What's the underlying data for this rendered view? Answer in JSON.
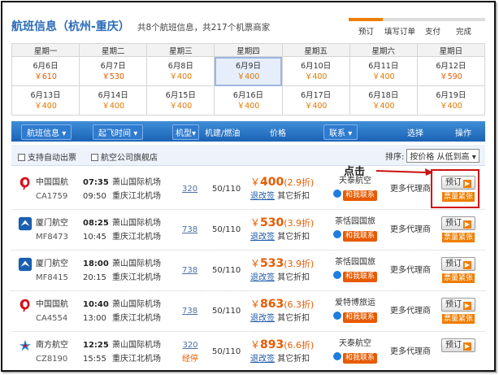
{
  "header": {
    "title": "航班信息（杭州-重庆）",
    "summary": "共8个航班信息，共217个机票商家"
  },
  "steps": [
    "预订",
    "填写订单",
    "支付",
    "完成"
  ],
  "calendar": {
    "weekdays": [
      "星期一",
      "星期二",
      "星期三",
      "星期四",
      "星期五",
      "星期六",
      "星期日"
    ],
    "weeks": [
      [
        {
          "date": "6月6日",
          "price": "￥610"
        },
        {
          "date": "6月7日",
          "price": "￥530"
        },
        {
          "date": "6月8日",
          "price": "￥400"
        },
        {
          "date": "6月9日",
          "price": "￥400"
        },
        {
          "date": "6月10日",
          "price": "￥400"
        },
        {
          "date": "6月11日",
          "price": "￥400"
        },
        {
          "date": "6月12日",
          "price": "￥590"
        }
      ],
      [
        {
          "date": "6月13日",
          "price": "￥400"
        },
        {
          "date": "6月14日",
          "price": "￥400"
        },
        {
          "date": "6月15日",
          "price": "￥400"
        },
        {
          "date": "6月16日",
          "price": "￥400"
        },
        {
          "date": "6月17日",
          "price": "￥400"
        },
        {
          "date": "6月18日",
          "price": "￥400"
        },
        {
          "date": "6月19日",
          "price": "￥400"
        }
      ]
    ],
    "selected": "6月9日"
  },
  "columns": {
    "flight_info": "航班信息",
    "depart_time": "起飞时间",
    "aircraft": "机型",
    "fuel": "机建/燃油",
    "price": "价格",
    "contact": "联系",
    "select": "选择",
    "action": "操作"
  },
  "filters": {
    "auto_issue": "支持自动出票",
    "flagship": "航空公司旗舰店",
    "sort_label": "排序:",
    "sort_value": "按价格 从低到高"
  },
  "annotation": "点击",
  "flights": [
    {
      "airline": "中国国航",
      "flight": "CA1759",
      "dep_time": "07:35",
      "arr_time": "09:50",
      "dep_airport": "萧山国际机场",
      "arr_airport": "重庆江北机场",
      "aircraft": "320",
      "aircraft_note": "",
      "fuel": "50/110",
      "price": "400",
      "discount": "(2.9折)",
      "refund": "退改签",
      "other": "其它折扣",
      "agency": "天泰航空",
      "help": "和我联系",
      "more": "更多代理商",
      "book": "预订",
      "tight": "票量紧张"
    },
    {
      "airline": "厦门航空",
      "flight": "MF8473",
      "dep_time": "08:25",
      "arr_time": "10:45",
      "dep_airport": "萧山国际机场",
      "arr_airport": "重庆江北机场",
      "aircraft": "738",
      "aircraft_note": "",
      "fuel": "50/110",
      "price": "530",
      "discount": "(3.9折)",
      "refund": "退改签",
      "other": "其它折扣",
      "agency": "茶恬园国旅",
      "help": "和我联系",
      "more": "更多代理商",
      "book": "预订",
      "tight": "票量紧张"
    },
    {
      "airline": "厦门航空",
      "flight": "MF8415",
      "dep_time": "18:00",
      "arr_time": "20:15",
      "dep_airport": "萧山国际机场",
      "arr_airport": "重庆江北机场",
      "aircraft": "738",
      "aircraft_note": "",
      "fuel": "50/110",
      "price": "533",
      "discount": "(3.9折)",
      "refund": "退改签",
      "other": "其它折扣",
      "agency": "茶恬园国旅",
      "help": "和我联系",
      "more": "更多代理商",
      "book": "预订",
      "tight": "票量紧张"
    },
    {
      "airline": "中国国航",
      "flight": "CA4554",
      "dep_time": "10:40",
      "arr_time": "13:00",
      "dep_airport": "萧山国际机场",
      "arr_airport": "重庆江北机场",
      "aircraft": "738",
      "aircraft_note": "",
      "fuel": "50/110",
      "price": "863",
      "discount": "(6.3折)",
      "refund": "退改签",
      "other": "其它折扣",
      "agency": "爱特博旅运",
      "help": "和我联系",
      "more": "更多代理商",
      "book": "预订",
      "tight": "票量紧张"
    },
    {
      "airline": "南方航空",
      "flight": "CZ8190",
      "dep_time": "12:25",
      "arr_time": "15:55",
      "dep_airport": "萧山国际机场",
      "arr_airport": "重庆江北机场",
      "aircraft": "320",
      "aircraft_note": "经停",
      "fuel": "50/110",
      "price": "893",
      "discount": "(6.6折)",
      "refund": "退改签",
      "other": "其它折扣",
      "agency": "天泰航空",
      "help": "和我联系",
      "more": "更多代理商",
      "book": "预订",
      "tight": ""
    }
  ],
  "colors": {
    "accent": "#2a6bb8",
    "price": "#e85a00",
    "bar": "#1b63b5",
    "highlight": "#d01010"
  }
}
